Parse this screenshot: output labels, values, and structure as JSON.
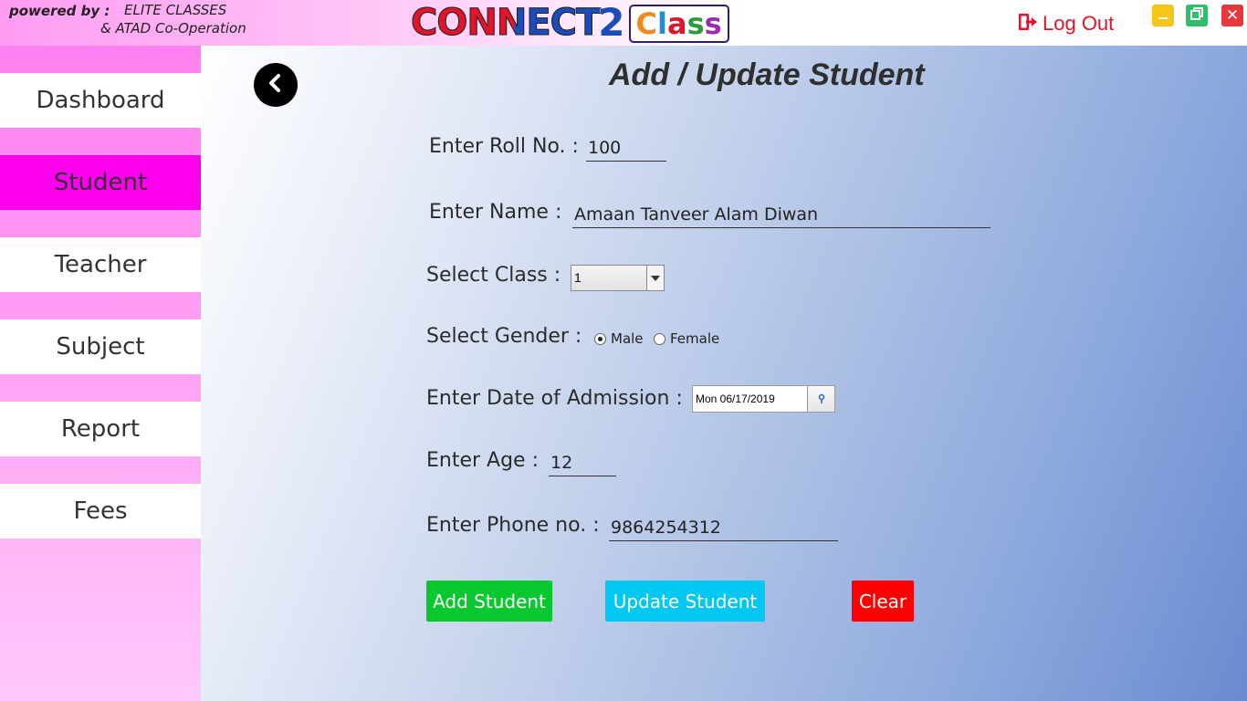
{
  "header": {
    "powered_label": "powered by :",
    "powered_org_1": "ELITE CLASSES",
    "powered_org_2": "& ATAD Co-Operation",
    "logo_connect": "CONNECT",
    "logo_number": "2",
    "logo_class": [
      "C",
      "l",
      "a",
      "s",
      "s"
    ],
    "logout_label": "Log Out",
    "close_glyph": "✕"
  },
  "sidebar": {
    "items": [
      {
        "label": "Dashboard",
        "active": false
      },
      {
        "label": "Student",
        "active": true
      },
      {
        "label": "Teacher",
        "active": false
      },
      {
        "label": "Subject",
        "active": false
      },
      {
        "label": "Report",
        "active": false
      },
      {
        "label": "Fees",
        "active": false
      }
    ]
  },
  "form": {
    "title": "Add / Update Student",
    "roll_label": "Enter Roll No. :",
    "roll_value": "100",
    "name_label": "Enter Name :",
    "name_value": "Amaan Tanveer Alam Diwan",
    "class_label": "Select Class :",
    "class_value": "1",
    "gender_label": "Select Gender :",
    "gender_options": [
      "Male",
      "Female"
    ],
    "gender_selected": "Male",
    "doa_label": "Enter Date of Admission :",
    "doa_value": "Mon 06/17/2019",
    "age_label": "Enter Age :",
    "age_value": "12",
    "phone_label": "Enter Phone no. :",
    "phone_value": "9864254312"
  },
  "actions": {
    "add_label": "Add Student",
    "update_label": "Update Student",
    "clear_label": "Clear"
  },
  "colors": {
    "sidebar_active": "#ff00ee",
    "add_button": "#07c82f",
    "update_button": "#00c8f0",
    "clear_button": "#ff0000",
    "logout": "#e0142b"
  },
  "icons": {
    "back": "chevron-left-icon",
    "logout": "logout-icon",
    "minimize": "minimize-icon",
    "restore": "restore-icon",
    "close": "close-icon",
    "dropdown": "chevron-down-icon",
    "calendar": "calendar-icon"
  }
}
